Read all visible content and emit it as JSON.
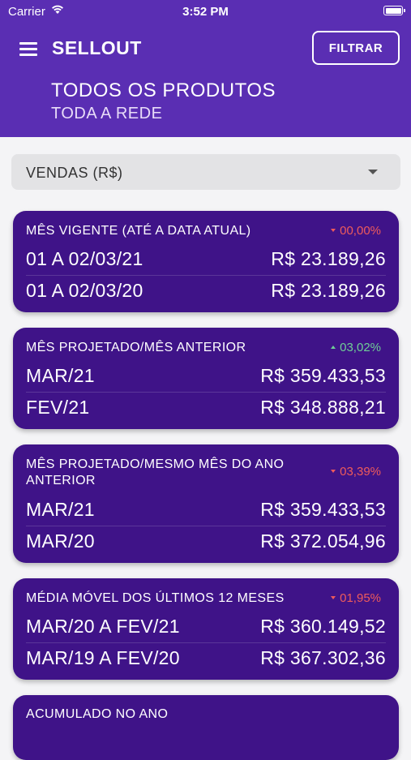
{
  "status": {
    "carrier": "Carrier",
    "time": "3:52 PM"
  },
  "appbar": {
    "title": "SELLOUT",
    "filter_label": "FILTRAR",
    "subtitle_main": "TODOS OS PRODUTOS",
    "subtitle_sub": "TODA A REDE",
    "color": "#5a2eb3"
  },
  "dropdown": {
    "selected": "VENDAS (R$)"
  },
  "cards": [
    {
      "title": "MÊS VIGENTE (ATÉ A DATA ATUAL)",
      "pct": "00,00%",
      "trend": "down",
      "rows": [
        {
          "label": "01 A 02/03/21",
          "value": "R$ 23.189,26"
        },
        {
          "label": "01 A 02/03/20",
          "value": "R$ 23.189,26"
        }
      ]
    },
    {
      "title": "MÊS PROJETADO/MÊS ANTERIOR",
      "pct": "03,02%",
      "trend": "up",
      "rows": [
        {
          "label": "MAR/21",
          "value": "R$ 359.433,53"
        },
        {
          "label": "FEV/21",
          "value": "R$ 348.888,21"
        }
      ]
    },
    {
      "title": "MÊS PROJETADO/MESMO MÊS DO ANO ANTERIOR",
      "pct": "03,39%",
      "trend": "down",
      "rows": [
        {
          "label": "MAR/21",
          "value": "R$ 359.433,53"
        },
        {
          "label": "MAR/20",
          "value": "R$ 372.054,96"
        }
      ]
    },
    {
      "title": "MÉDIA MÓVEL DOS ÚLTIMOS 12 MESES",
      "pct": "01,95%",
      "trend": "down",
      "rows": [
        {
          "label": "MAR/20 A FEV/21",
          "value": "R$ 360.149,52"
        },
        {
          "label": "MAR/19 A FEV/20",
          "value": "R$ 367.302,36"
        }
      ]
    },
    {
      "title": "ACUMULADO NO ANO"
    }
  ],
  "colors": {
    "card": "#3f1388",
    "down": "#ef5b5b",
    "up": "#6fcf97"
  },
  "icons": [
    "wifi-icon",
    "battery-icon",
    "menu-icon",
    "caret-down-icon",
    "arrow-down-icon",
    "arrow-up-icon"
  ]
}
